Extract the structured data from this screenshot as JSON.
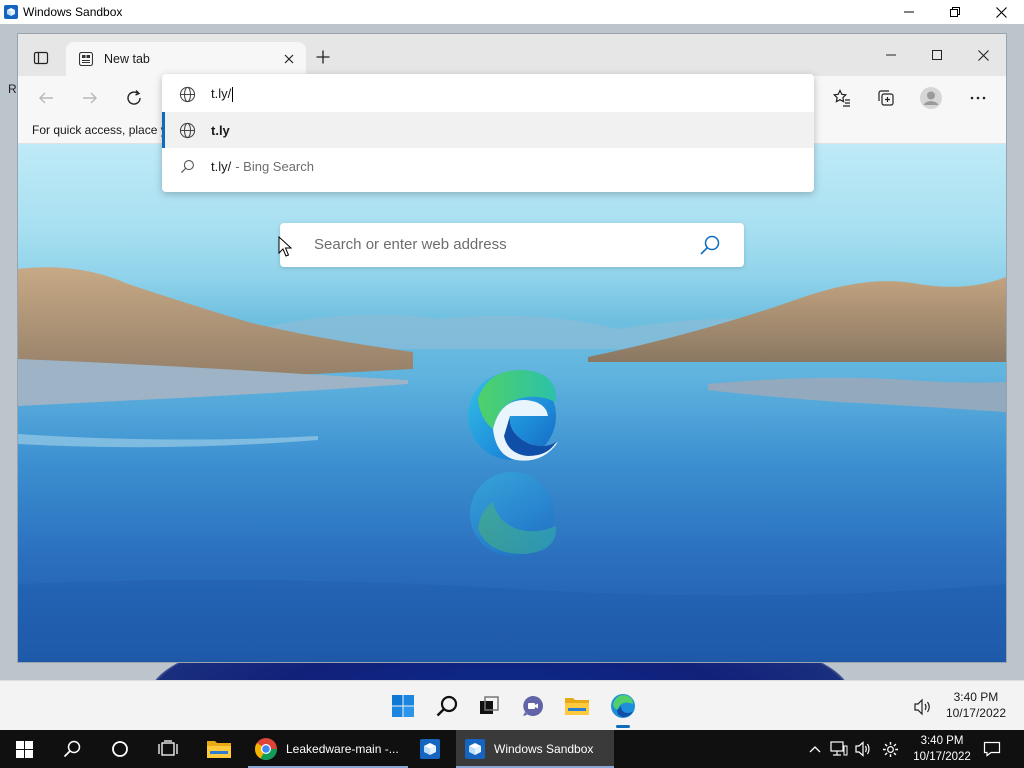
{
  "sandbox": {
    "title": "Windows Sandbox",
    "stray_letter": "R"
  },
  "browser": {
    "tab": {
      "title": "New tab"
    },
    "address_input": {
      "value": "t.ly/"
    },
    "favorites_bar": {
      "text": "For quick access, place y"
    },
    "suggestions": [
      {
        "icon": "globe-icon",
        "text": "t.ly",
        "subtext": ""
      },
      {
        "icon": "search-icon",
        "text": "t.ly/",
        "subtext": "- Bing Search"
      }
    ],
    "ntp_search": {
      "placeholder": "Search or enter web address"
    }
  },
  "sandbox_taskbar": {
    "time": "3:40 PM",
    "date": "10/17/2022"
  },
  "host_taskbar": {
    "apps": [
      {
        "name": "chrome",
        "label": "Leakedware-main -..."
      },
      {
        "name": "windows-sandbox",
        "label": "Windows Sandbox"
      }
    ],
    "time": "3:40 PM",
    "date": "10/17/2022"
  },
  "colors": {
    "accent": "#0f6cbd",
    "host_taskbar": "#101010",
    "highlight_row": "#f1f1f1"
  }
}
